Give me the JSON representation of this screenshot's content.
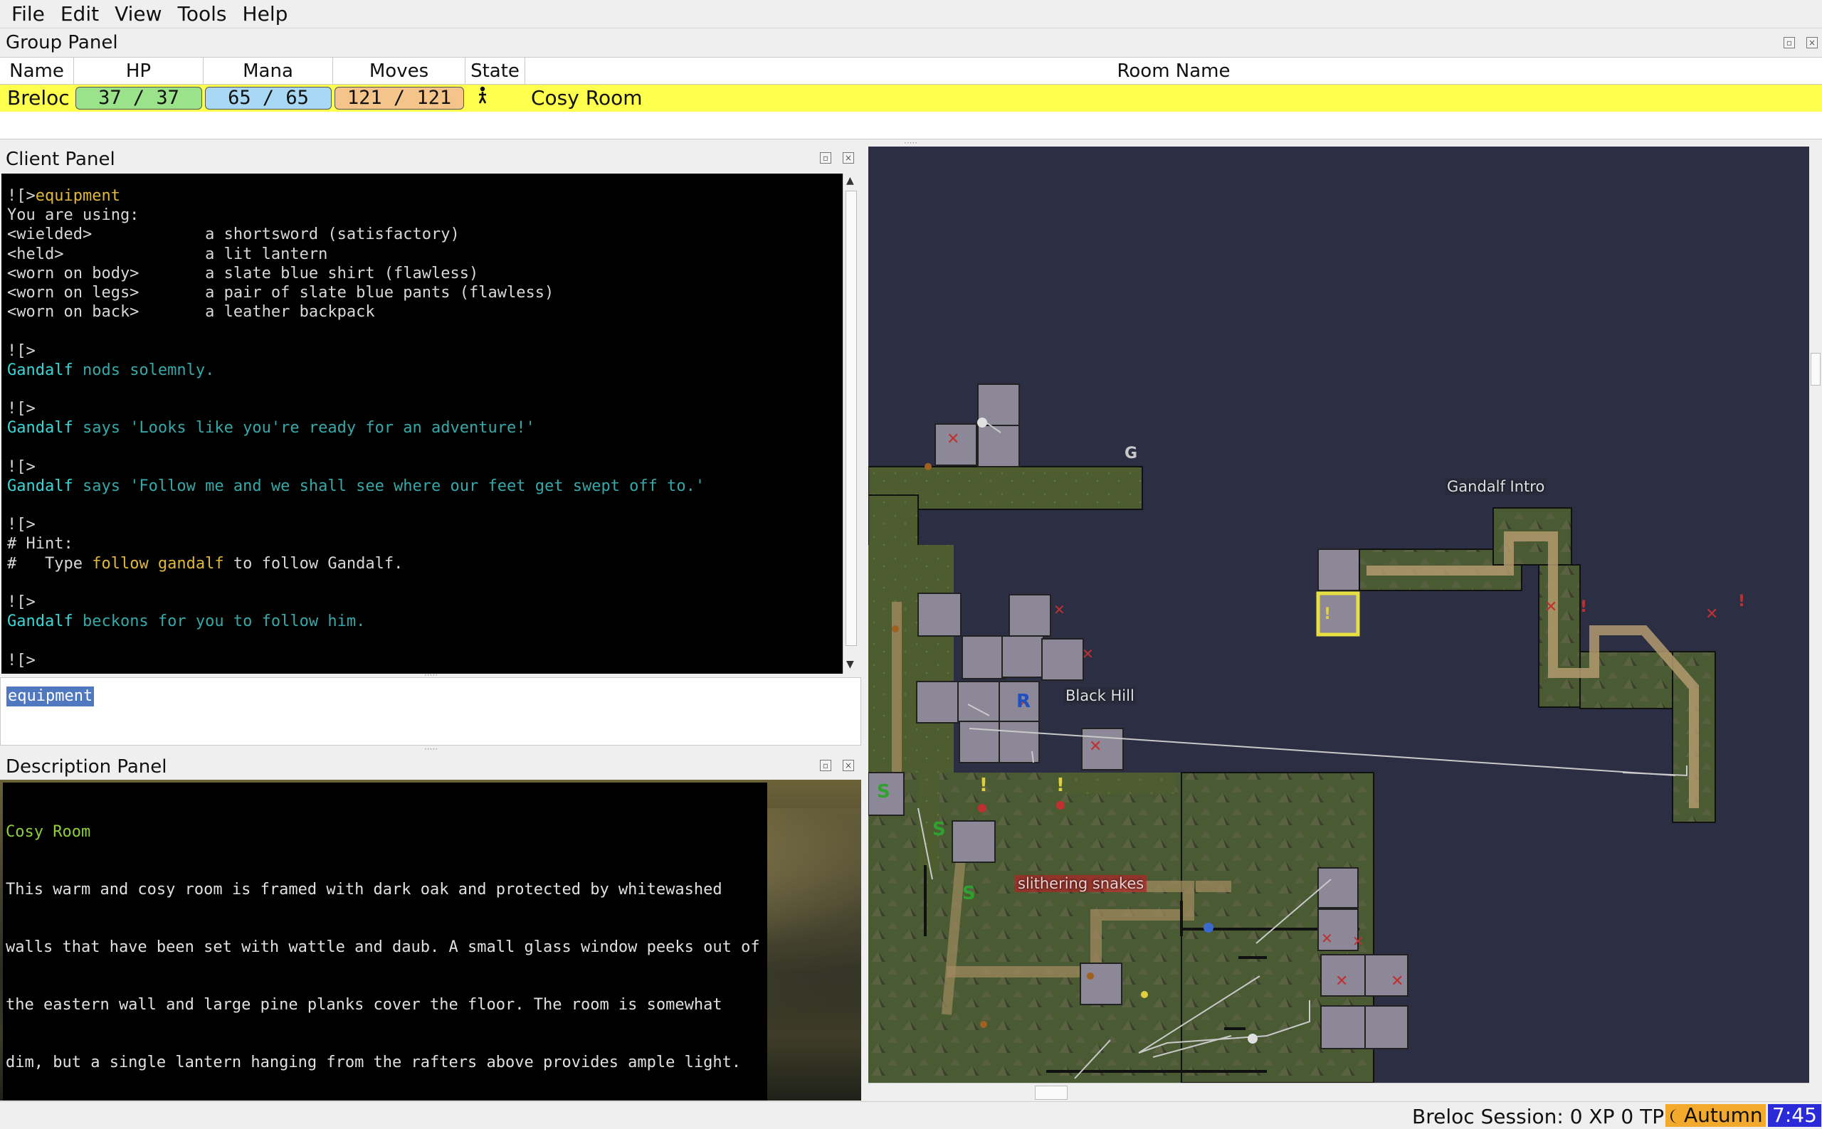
{
  "menu": [
    "File",
    "Edit",
    "View",
    "Tools",
    "Help"
  ],
  "group_panel": {
    "title": "Group Panel",
    "columns": [
      "Name",
      "HP",
      "Mana",
      "Moves",
      "State",
      "Room Name"
    ],
    "row": {
      "name": "Breloc",
      "hp": "37 / 37",
      "mana": "65 / 65",
      "moves": "121 / 121",
      "state_icon": "walking-person-icon",
      "room": "Cosy Room"
    },
    "colors": {
      "row_bg": "#ffff4d",
      "hp": "#9be38a",
      "mana": "#a9d8f5",
      "moves": "#f5c48b"
    }
  },
  "client_panel": {
    "title": "Client Panel",
    "lines": [
      [
        {
          "t": "![>",
          "c": "p"
        },
        {
          "t": "equipment",
          "c": "cmd"
        }
      ],
      [
        {
          "t": "You are using:",
          "c": "p"
        }
      ],
      [
        {
          "t": "<wielded>            a shortsword (satisfactory)",
          "c": "p"
        }
      ],
      [
        {
          "t": "<held>               a lit lantern",
          "c": "p"
        }
      ],
      [
        {
          "t": "<worn on body>       a slate blue shirt (flawless)",
          "c": "p"
        }
      ],
      [
        {
          "t": "<worn on legs>       a pair of slate blue pants (flawless)",
          "c": "p"
        }
      ],
      [
        {
          "t": "<worn on back>       a leather backpack",
          "c": "p"
        }
      ],
      [
        {
          "t": "",
          "c": "p"
        }
      ],
      [
        {
          "t": "![>",
          "c": "p"
        }
      ],
      [
        {
          "t": "Gandalf",
          "c": "name"
        },
        {
          "t": " nods solemnly.",
          "c": "speech"
        }
      ],
      [
        {
          "t": "",
          "c": "p"
        }
      ],
      [
        {
          "t": "![>",
          "c": "p"
        }
      ],
      [
        {
          "t": "Gandalf",
          "c": "name"
        },
        {
          "t": " says 'Looks like you're ready for an adventure!'",
          "c": "speech"
        }
      ],
      [
        {
          "t": "",
          "c": "p"
        }
      ],
      [
        {
          "t": "![>",
          "c": "p"
        }
      ],
      [
        {
          "t": "Gandalf",
          "c": "name"
        },
        {
          "t": " says 'Follow me and we shall see where our feet get swept off to.'",
          "c": "speech"
        }
      ],
      [
        {
          "t": "",
          "c": "p"
        }
      ],
      [
        {
          "t": "![>",
          "c": "p"
        }
      ],
      [
        {
          "t": "# Hint:",
          "c": "p"
        }
      ],
      [
        {
          "t": "#   Type ",
          "c": "p"
        },
        {
          "t": "follow gandalf",
          "c": "hl"
        },
        {
          "t": " to follow Gandalf.",
          "c": "p"
        }
      ],
      [
        {
          "t": "",
          "c": "p"
        }
      ],
      [
        {
          "t": "![>",
          "c": "p"
        }
      ],
      [
        {
          "t": "Gandalf",
          "c": "name"
        },
        {
          "t": " beckons for you to follow him.",
          "c": "speech"
        }
      ],
      [
        {
          "t": "",
          "c": "p"
        }
      ],
      [
        {
          "t": "![>",
          "c": "p"
        }
      ]
    ],
    "input_value": "equipment"
  },
  "description_panel": {
    "title": "Description Panel",
    "room_name": "Cosy Room",
    "text_lines": [
      "This warm and cosy room is framed with dark oak and protected by whitewashed",
      "walls that have been set with wattle and daub. A small glass window peeks out of",
      "the eastern wall and large pine planks cover the floor. The room is somewhat",
      "dim, but a single lantern hanging from the rafters above provides ample light."
    ],
    "image_icon": "mountain-landscape-image"
  },
  "map": {
    "labels": {
      "intro": "Gandalf Intro",
      "hill": "Black Hill",
      "snakes": "slithering snakes"
    },
    "colors": {
      "background": "#2c2e43",
      "grass": "#4a5a32",
      "room_indoor": "#8d8897",
      "selected": "#e8e040"
    }
  },
  "status": {
    "session": "Breloc Session: 0 XP 0 TP",
    "season": "Autumn",
    "time": "7:45",
    "moon_icon": "crescent-moon-icon"
  }
}
